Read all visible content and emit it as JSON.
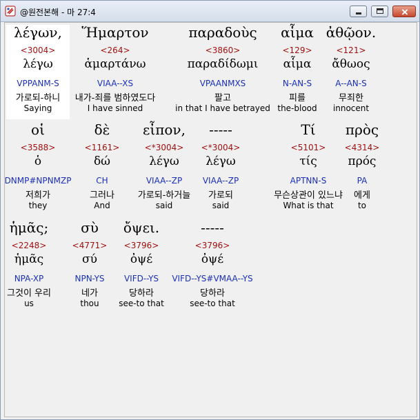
{
  "window": {
    "title": "@원전본해 - 마 27:4",
    "icons": {
      "app": "bible-app-icon",
      "minimize": "minimize-icon",
      "maximize": "maximize-icon",
      "close": "close-icon"
    }
  },
  "rows": [
    [
      {
        "greek": "λέγων,",
        "strong": "<3004>",
        "lexeme": "λέγω",
        "parse": "VPPANM-S",
        "korean": "가로되-하니",
        "english": "Saying"
      },
      {
        "greek": "Ἥμαρτον",
        "strong": "<264>",
        "lexeme": "ἁμαρτάνω",
        "parse": "VIAA--XS",
        "korean": "내가-죄를 범하였도다",
        "english": "I have sinned"
      },
      {
        "greek": "παραδοὺς",
        "strong": "<3860>",
        "lexeme": "παραδίδωμι",
        "parse": "VPAANMXS",
        "korean": "팔고",
        "english": "in that I have betrayed"
      },
      {
        "greek": "αἷμα",
        "strong": "<129>",
        "lexeme": "αἷμα",
        "parse": "N-AN-S",
        "korean": "피를",
        "english": "the-blood"
      },
      {
        "greek": "ἀθῷον.",
        "strong": "<121>",
        "lexeme": "ἄθωος",
        "parse": "A--AN-S",
        "korean": "무죄한",
        "english": "innocent"
      }
    ],
    [
      {
        "greek": "οἱ",
        "strong": "<3588>",
        "lexeme": "ὁ",
        "parse": "DNMP#NPNMZP",
        "korean": "저희가",
        "english": "they"
      },
      {
        "greek": "δὲ",
        "strong": "<1161>",
        "lexeme": "δώ",
        "parse": "CH",
        "korean": "그러나",
        "english": "And"
      },
      {
        "greek": "εἶπον,",
        "strong": "<*3004>",
        "lexeme": "λέγω",
        "parse": "VIAA--ZP",
        "korean": "가로되-하거늘",
        "english": "said"
      },
      {
        "greek": "-----",
        "strong": "<*3004>",
        "lexeme": "λέγω",
        "parse": "VIAA--ZP",
        "korean": "가로되",
        "english": "said"
      },
      {
        "greek": "Τί",
        "strong": "<5101>",
        "lexeme": "τίς",
        "parse": "APTNN-S",
        "korean": "무슨상관이 있느냐",
        "english": "What is that"
      },
      {
        "greek": "πρὸς",
        "strong": "<4314>",
        "lexeme": "πρός",
        "parse": "PA",
        "korean": "에게",
        "english": "to"
      }
    ],
    [
      {
        "greek": "ἡμᾶς;",
        "strong": "<2248>",
        "lexeme": "ἡμᾶς",
        "parse": "NPA-XP",
        "korean": "그것이 우리",
        "english": "us"
      },
      {
        "greek": "σὺ",
        "strong": "<4771>",
        "lexeme": "σύ",
        "parse": "NPN-YS",
        "korean": "네가",
        "english": "thou"
      },
      {
        "greek": "ὄψει.",
        "strong": "<3796>",
        "lexeme": "ὀψέ",
        "parse": "VIFD--YS",
        "korean": "당하라",
        "english": "see-to that"
      },
      {
        "greek": "-----",
        "strong": "<3796>",
        "lexeme": "ὀψέ",
        "parse": "VIFD--YS#VMAA--YS",
        "korean": "당하라",
        "english": "see-to that"
      }
    ]
  ]
}
